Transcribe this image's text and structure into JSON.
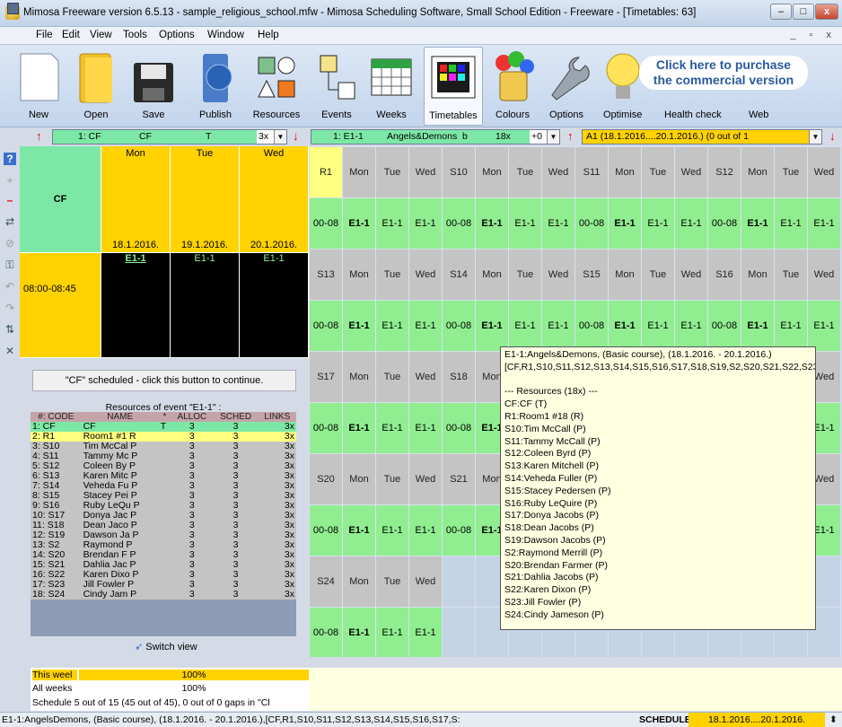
{
  "window": {
    "title": "Mimosa Freeware version 6.5.13 - sample_religious_school.mfw - Mimosa Scheduling Software, Small School Edition - Freeware - [Timetables: 63]"
  },
  "menu": [
    "File",
    "Edit",
    "View",
    "Tools",
    "Options",
    "Window",
    "Help"
  ],
  "toolbar": [
    "New",
    "Open",
    "Save",
    "Publish",
    "Resources",
    "Events",
    "Weeks",
    "Timetables",
    "Colours",
    "Options",
    "Optimise",
    "Health check",
    "Web"
  ],
  "ad_text": [
    "Click here to purchase",
    "the commercial version"
  ],
  "selectors": {
    "left_combo": {
      "code": "1: CF",
      "name": "CF",
      "type": "T",
      "count": "3x"
    },
    "mid_combo": {
      "code": "1: E1-1",
      "name": "Angels&Demons",
      "type": "b",
      "count": "18x",
      "offset": "+0"
    },
    "right_combo": "A1 (18.1.2016....20.1.2016.) (0 out of 1"
  },
  "left_timetable": {
    "days": [
      "Mon",
      "Tue",
      "Wed"
    ],
    "resource": "CF",
    "dates": [
      "18.1.2016.",
      "19.1.2016.",
      "20.1.2016."
    ],
    "time": "08:00-08:45",
    "events": [
      "E1-1",
      "E1-1",
      "E1-1"
    ],
    "continue_button": "\"CF\" scheduled - click this button to continue."
  },
  "resources_panel": {
    "title": "Resources of event \"E1-1\" :",
    "headers": [
      "#: CODE",
      "NAME",
      "*",
      "ALLOC",
      "SCHED",
      "LINKS"
    ],
    "rows": [
      [
        "1: CF",
        "CF",
        "T",
        "3",
        "3",
        "3x"
      ],
      [
        "2: R1",
        "Room1 #1 R",
        "",
        "3",
        "3",
        "3x"
      ],
      [
        "3: S10",
        "Tim McCal P",
        "",
        "3",
        "3",
        "3x"
      ],
      [
        "4: S11",
        "Tammy Mc P",
        "",
        "3",
        "3",
        "3x"
      ],
      [
        "5: S12",
        "Coleen By P",
        "",
        "3",
        "3",
        "3x"
      ],
      [
        "6: S13",
        "Karen Mitc P",
        "",
        "3",
        "3",
        "3x"
      ],
      [
        "7: S14",
        "Veheda Fu P",
        "",
        "3",
        "3",
        "3x"
      ],
      [
        "8: S15",
        "Stacey Pei P",
        "",
        "3",
        "3",
        "3x"
      ],
      [
        "9: S16",
        "Ruby LeQu P",
        "",
        "3",
        "3",
        "3x"
      ],
      [
        "10: S17",
        "Donya Jac P",
        "",
        "3",
        "3",
        "3x"
      ],
      [
        "11: S18",
        "Dean Jaco P",
        "",
        "3",
        "3",
        "3x"
      ],
      [
        "12: S19",
        "Dawson Ja P",
        "",
        "3",
        "3",
        "3x"
      ],
      [
        "13: S2",
        "Raymond P",
        "",
        "3",
        "3",
        "3x"
      ],
      [
        "14: S20",
        "Brendan F P",
        "",
        "3",
        "3",
        "3x"
      ],
      [
        "15: S21",
        "Dahlia Jac P",
        "",
        "3",
        "3",
        "3x"
      ],
      [
        "16: S22",
        "Karen Dixo P",
        "",
        "3",
        "3",
        "3x"
      ],
      [
        "17: S23",
        "Jill Fowler P",
        "",
        "3",
        "3",
        "3x"
      ],
      [
        "18: S24",
        "Cindy Jam P",
        "",
        "3",
        "3",
        "3x"
      ]
    ],
    "switch_view": "Switch view"
  },
  "grid": {
    "days": [
      "Mon",
      "Tue",
      "Wed"
    ],
    "time": "00-08",
    "event": "E1-1",
    "resources": [
      "R1",
      "S10",
      "S11",
      "S12",
      "S13",
      "S14",
      "S15",
      "S16",
      "S17",
      "S18",
      "S19",
      "S2",
      "S20",
      "S21",
      "S22",
      "S23",
      "S24"
    ]
  },
  "tooltip": "E1-1:Angels&Demons, (Basic course), (18.1.2016. - 20.1.2016.)\n[CF,R1,S10,S11,S12,S13,S14,S15,S16,S17,S18,S19,S2,S20,S21,S22,S23,S24]\n\n--- Resources (18x) ---\nCF:CF (T)\nR1:Room1 #18 (R)\nS10:Tim McCall (P)\nS11:Tammy McCall (P)\nS12:Coleen Byrd (P)\nS13:Karen Mitchell (P)\nS14:Veheda Fuller (P)\nS15:Stacey Pedersen (P)\nS16:Ruby LeQuire (P)\nS17:Donya Jacobs (P)\nS18:Dean Jacobs (P)\nS19:Dawson Jacobs (P)\nS2:Raymond Merrill (P)\nS20:Brendan Farmer (P)\nS21:Dahlia Jacobs (P)\nS22:Karen Dixon (P)\nS23:Jill Fowler (P)\nS24:Cindy Jameson (P)",
  "progress": {
    "this_week_label": "This weel",
    "this_week_value": "100%",
    "this_week_fraction": 1.0,
    "all_weeks_label": "All weeks",
    "all_weeks_value": "100%",
    "all_weeks_fraction": 1.0,
    "schedule_text": "Schedule 5 out of 15 (45 out of 45), 0 out of 0 gaps in \"Cl"
  },
  "status": {
    "left": "E1-1:AngelsDemons, (Basic course), (18.1.2016. - 20.1.2016.),[CF,R1,S10,S11,S12,S13,S14,S15,S16,S17,S:",
    "mode": "SCHEDULE",
    "range": "18.1.2016....20.1.2016."
  },
  "colors": {
    "event_yellow": "#ffd200",
    "scheduled_green": "#90ee90",
    "resource_green": "#7de8a6",
    "highlight_yellow": "#ffff80",
    "tooltip_bg": "#ffffe1"
  }
}
